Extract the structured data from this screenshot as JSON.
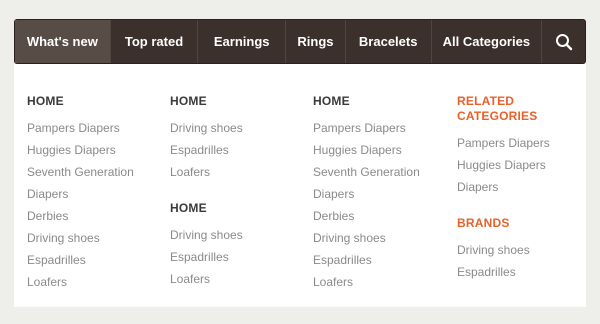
{
  "nav": {
    "items": [
      "What's new",
      "Top rated",
      "Earnings",
      "Rings",
      "Bracelets",
      "All Categories"
    ],
    "search_icon": "search-icon"
  },
  "columns": [
    {
      "heading": "HOME",
      "links": [
        "Pampers Diapers",
        "Huggies Diapers",
        "Seventh Generation",
        "Diapers",
        "Derbies",
        "Driving shoes",
        "Espadrilles",
        "Loafers"
      ]
    },
    {
      "heading": "HOME",
      "links": [
        "Driving shoes",
        "Espadrilles",
        "Loafers"
      ],
      "heading2": "HOME",
      "links2": [
        "Driving shoes",
        "Espadrilles",
        "Loafers"
      ]
    },
    {
      "heading": "HOME",
      "links": [
        "Pampers Diapers",
        "Huggies Diapers",
        "Seventh Generation",
        "Diapers",
        "Derbies",
        "Driving shoes",
        "Espadrilles",
        "Loafers"
      ]
    },
    {
      "heading_line1": "RELATED",
      "heading_line2": "CATEGORIES",
      "links": [
        "Pampers Diapers",
        "Huggies Diapers",
        "Diapers"
      ],
      "heading2": "BRANDS",
      "links2": [
        "Driving shoes",
        "Espadrilles"
      ]
    }
  ],
  "colors": {
    "nav_bg": "#3b302c",
    "nav_active": "#584c46",
    "accent": "#e8612a",
    "link": "#8a8a8a",
    "heading": "#3a3a3a"
  }
}
